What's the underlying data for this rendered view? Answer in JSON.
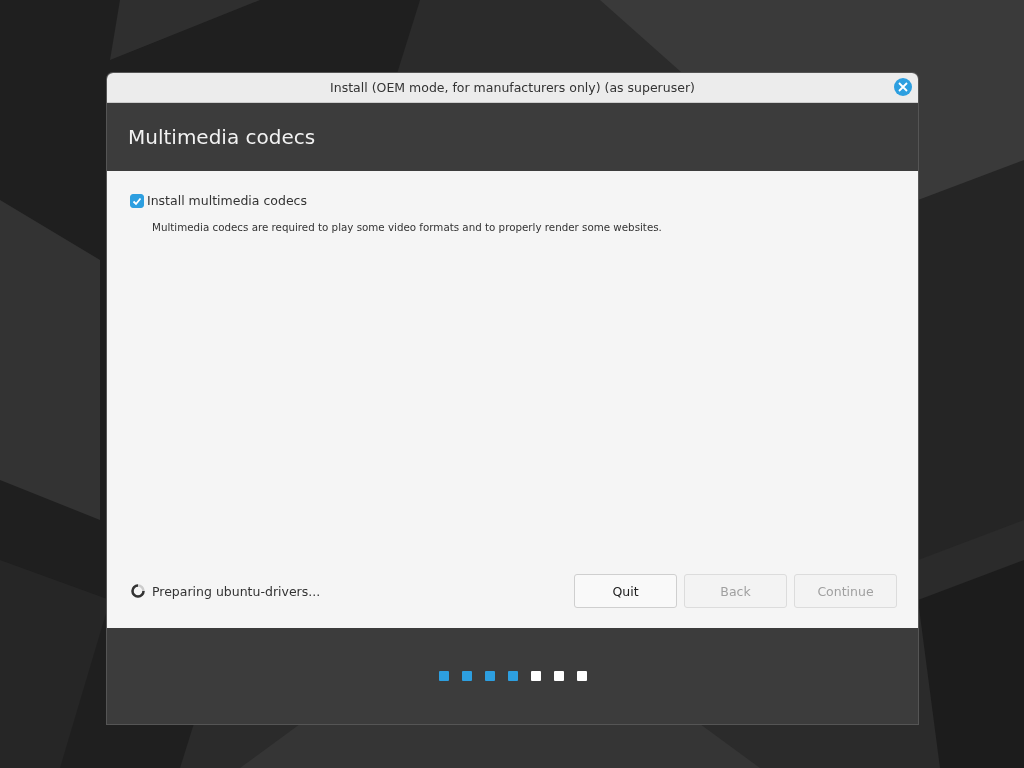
{
  "window": {
    "title": "Install (OEM mode, for manufacturers only) (as superuser)"
  },
  "header": {
    "title": "Multimedia codecs"
  },
  "option": {
    "label": "Install multimedia codecs",
    "checked": true,
    "description": "Multimedia codecs are required to play some video formats and to properly render some websites."
  },
  "status": {
    "text": "Preparing ubuntu-drivers..."
  },
  "buttons": [
    {
      "label": "Quit",
      "disabled": false
    },
    {
      "label": "Back",
      "disabled": true
    },
    {
      "label": "Continue",
      "disabled": true
    }
  ],
  "steps": [
    {
      "done": true
    },
    {
      "done": true
    },
    {
      "done": true
    },
    {
      "done": true
    },
    {
      "done": false
    },
    {
      "done": false
    },
    {
      "done": false
    }
  ]
}
